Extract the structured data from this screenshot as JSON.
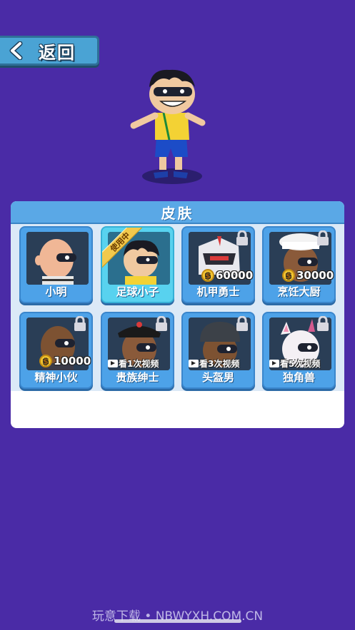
{
  "header": {
    "back_label": "返回"
  },
  "panel": {
    "title": "皮肤"
  },
  "skins": [
    {
      "name": "小明",
      "cost": "",
      "video": "",
      "badge": ""
    },
    {
      "name": "足球小子",
      "cost": "",
      "video": "",
      "badge": "使用中"
    },
    {
      "name": "机甲勇士",
      "cost": "60000",
      "video": "",
      "badge": ""
    },
    {
      "name": "烹饪大厨",
      "cost": "30000",
      "video": "",
      "badge": ""
    },
    {
      "name": "精神小伙",
      "cost": "10000",
      "video": "",
      "badge": ""
    },
    {
      "name": "贵族绅士",
      "cost": "",
      "video": "看1次视频",
      "badge": ""
    },
    {
      "name": "头盔男",
      "cost": "",
      "video": "看3次视频",
      "badge": ""
    },
    {
      "name": "独角兽",
      "cost": "",
      "video": "看5次视频",
      "badge": ""
    }
  ],
  "watermark": "玩意下载 • NBWYXH.COM.CN",
  "colors": {
    "background": "#4a2ba6",
    "card": "#4da2e8",
    "card_selected": "#58d2ef",
    "header": "#5aa8e6"
  }
}
